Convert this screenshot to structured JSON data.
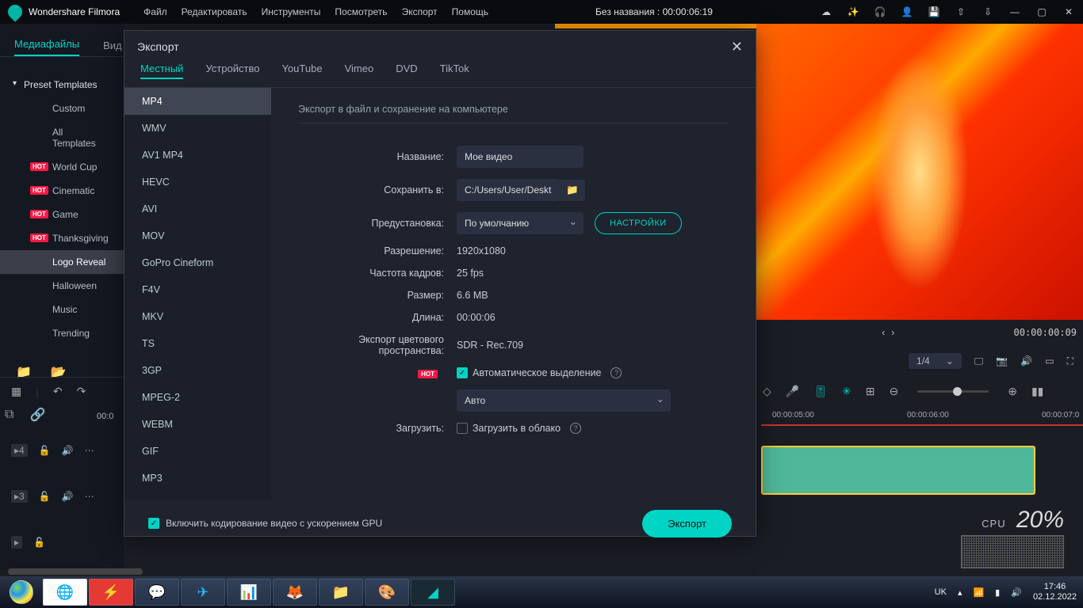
{
  "app": {
    "name": "Wondershare Filmora",
    "project_title": "Без названия : 00:00:06:19"
  },
  "menu": {
    "file": "Файл",
    "edit": "Редактировать",
    "tools": "Инструменты",
    "view": "Посмотреть",
    "export": "Экспорт",
    "help": "Помощь"
  },
  "sidebar": {
    "tab_media": "Медиафайлы",
    "tab_other": "Вид",
    "header": "Preset Templates",
    "items": [
      "Custom",
      "All Templates",
      "World Cup",
      "Cinematic",
      "Game",
      "Thanksgiving",
      "Logo Reveal",
      "Halloween",
      "Music",
      "Trending"
    ],
    "hot_idx": [
      2,
      3,
      4,
      5
    ],
    "selected_idx": 6
  },
  "timeline": {
    "tc0": "00:0",
    "ruler": [
      "00:00:05:00",
      "00:00:06:00",
      "00:00:07:0"
    ],
    "tracks": [
      {
        "n": "4"
      },
      {
        "n": "3"
      },
      {
        "n": ""
      }
    ]
  },
  "preview": {
    "tc_left": "",
    "tc_right": "00:00:00:09",
    "zoom": "1/4"
  },
  "dialog": {
    "title": "Экспорт",
    "tabs": [
      "Местный",
      "Устройство",
      "YouTube",
      "Vimeo",
      "DVD",
      "TikTok"
    ],
    "active_tab": 0,
    "formats": [
      "MP4",
      "WMV",
      "AV1 MP4",
      "HEVC",
      "AVI",
      "MOV",
      "GoPro Cineform",
      "F4V",
      "MKV",
      "TS",
      "3GP",
      "MPEG-2",
      "WEBM",
      "GIF",
      "MP3"
    ],
    "active_format": 0,
    "desc": "Экспорт в файл и сохранение на компьютере",
    "labels": {
      "name": "Название:",
      "save": "Сохранить в:",
      "preset": "Предустановка:",
      "res": "Разрешение:",
      "fps": "Частота кадров:",
      "size": "Размер:",
      "len": "Длина:",
      "color": "Экспорт цветового пространства:",
      "auto_hl": "Автоматическое выделение",
      "upload": "Загрузить:",
      "upload_chk": "Загрузить в облако",
      "gpu": "Включить кодирование видео с ускорением GPU"
    },
    "values": {
      "name": "Мое видео",
      "save": "C:/Users/User/Desktc",
      "preset": "По умолчанию",
      "settings_btn": "НАСТРОЙКИ",
      "res": "1920x1080",
      "fps": "25 fps",
      "size": "6.6 MB",
      "len": "00:00:06",
      "color": "SDR - Rec.709",
      "auto_sel": "Авто",
      "hot": "HOT"
    },
    "export_btn": "Экспорт"
  },
  "cpu": {
    "label": "CPU",
    "value": "20%"
  },
  "taskbar": {
    "lang": "UK",
    "time": "17:46",
    "date": "02.12.2022"
  }
}
